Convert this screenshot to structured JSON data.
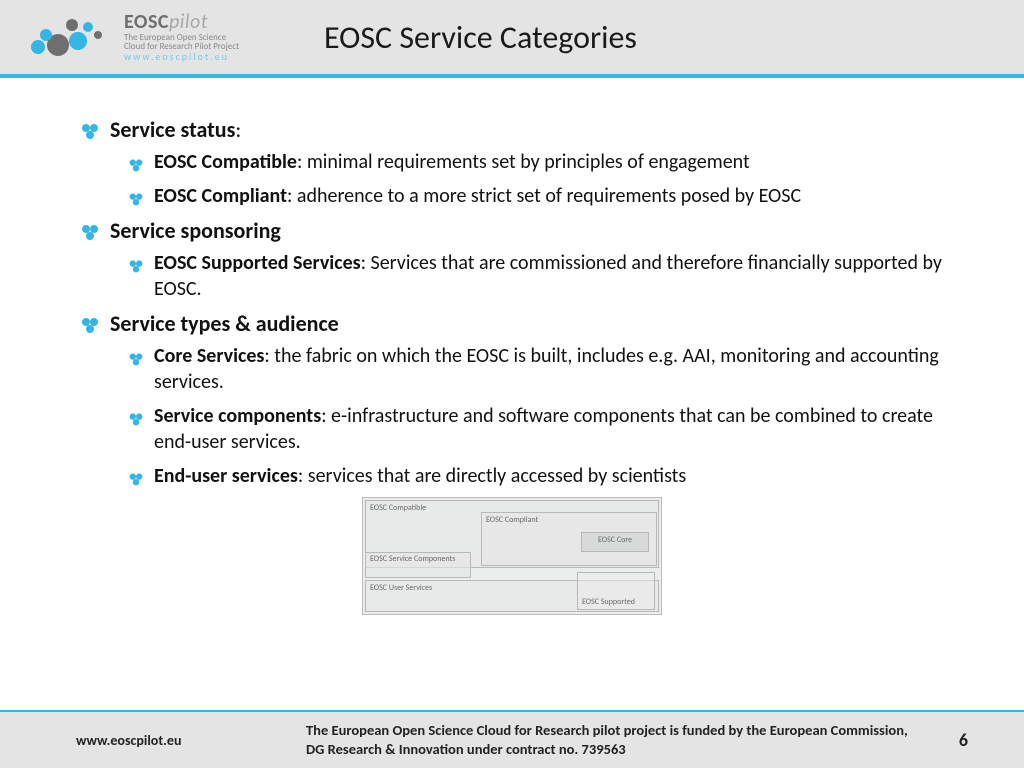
{
  "header": {
    "logo_main": "EOSC",
    "logo_suffix": "pilot",
    "logo_sub1": "The European Open Science",
    "logo_sub2": "Cloud for Research Pilot Project",
    "logo_url": "www.eoscpilot.eu",
    "title": "EOSC Service Categories"
  },
  "sections": [
    {
      "heading": "Service status",
      "heading_suffix": ":",
      "items": [
        {
          "label": "EOSC Compatible",
          "desc": ": minimal requirements set by principles of engagement"
        },
        {
          "label": "EOSC Compliant",
          "desc": ": adherence to a more strict set of requirements posed by EOSC"
        }
      ]
    },
    {
      "heading": "Service sponsoring",
      "heading_suffix": "",
      "items": [
        {
          "label": "EOSC Supported Services",
          "desc": ": Services that are commissioned and therefore financially supported by EOSC."
        }
      ]
    },
    {
      "heading": "Service types & audience",
      "heading_suffix": "",
      "items": [
        {
          "label": "Core Services",
          "desc": ": the fabric on which the EOSC is built, includes e.g. AAI, monitoring and accounting services."
        },
        {
          "label": "Service components",
          "desc": ": e-infrastructure and software components that can be combined to create end-user services."
        },
        {
          "label": "End-user services",
          "desc": ": services that are directly accessed by scientists"
        }
      ]
    }
  ],
  "diagram": {
    "compatible": "EOSC Compatible",
    "compliant": "EOSC Compliant",
    "core": "EOSC Core",
    "components": "EOSC Service Components",
    "user": "EOSC User Services",
    "supported": "EOSC Supported"
  },
  "footer": {
    "url": "www.eoscpilot.eu",
    "text": "The European Open Science Cloud for Research pilot project is funded by the European Commission, DG Research & Innovation under contract no. 739563",
    "page": "6"
  }
}
